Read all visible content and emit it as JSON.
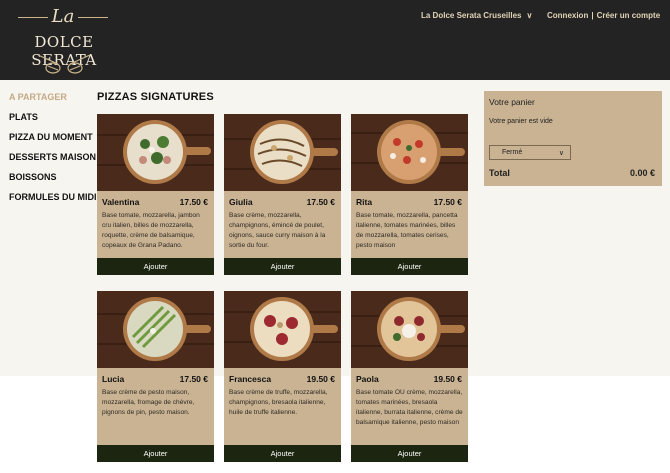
{
  "header": {
    "logo_script": "La",
    "logo_name": "DOLCE SERATA",
    "store_label": "La Dolce Serata Cruseilles",
    "login": "Connexion",
    "separator": "|",
    "signup": "Créer un compte"
  },
  "sidebar": {
    "items": [
      {
        "label": "A PARTAGER"
      },
      {
        "label": "PLATS"
      },
      {
        "label": "PIZZA DU MOMENT"
      },
      {
        "label": "DESSERTS MAISON"
      },
      {
        "label": "BOISSONS"
      },
      {
        "label": "FORMULES DU MIDI"
      }
    ]
  },
  "section_title": "PIZZAS SIGNATURES",
  "products": [
    {
      "name": "Valentina",
      "price": "17.50 €",
      "desc": "Base tomate, mozzarella, jambon cru italien, billes de mozzarella, roquette, crème de balsamique, copeaux de Grana Padano.",
      "add": "Ajouter"
    },
    {
      "name": "Giulia",
      "price": "17.50 €",
      "desc": "Base crème, mozzarella, champignons, émincé de poulet, oignons, sauce curry maison à la sortie du four.",
      "add": "Ajouter"
    },
    {
      "name": "Rita",
      "price": "17.50 €",
      "desc": "Base tomate, mozzarella, pancetta italienne, tomates marinées, billes de mozzarella, tomates cerises, pesto maison",
      "add": "Ajouter"
    },
    {
      "name": "Lucia",
      "price": "17.50 €",
      "desc": "Base crème de pesto maison, mozzarella, fromage de chèvre, pignons de pin, pesto maison.",
      "add": "Ajouter"
    },
    {
      "name": "Francesca",
      "price": "19.50 €",
      "desc": "Base crème de truffe, mozzarella, champignons, bresaola italienne, huile de truffe italienne.",
      "add": "Ajouter"
    },
    {
      "name": "Paola",
      "price": "19.50 €",
      "desc": "Base tomate OU crème, mozzarella, tomates marinées, bresaola italienne, burrata italienne, crème de balsamique italienne, pesto maison",
      "add": "Ajouter"
    }
  ],
  "cart": {
    "title": "Votre panier",
    "empty": "Votre panier est vide",
    "select_value": "Fermé",
    "total_label": "Total",
    "total_value": "0.00 €"
  },
  "colors": {
    "header_bg": "#232323",
    "card_bg": "#c9b393",
    "button_bg": "#1c250f",
    "active_nav": "#c4a984"
  }
}
